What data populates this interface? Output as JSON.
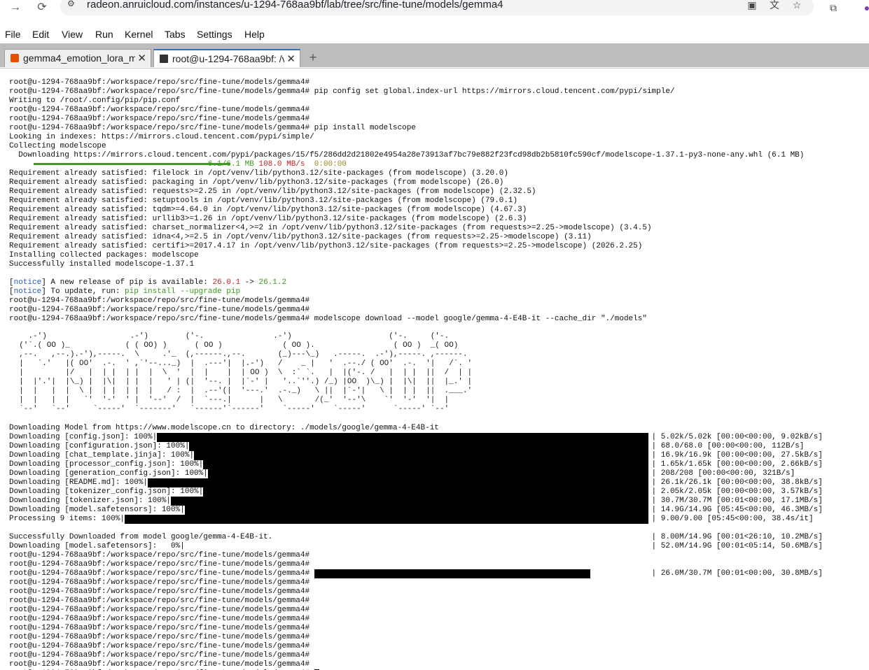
{
  "browser": {
    "url": "radeon.anruicloud.com/instances/u-1294-768aa9bf/lab/tree/src/fine-tune/models/gemma4"
  },
  "menu": [
    "File",
    "Edit",
    "View",
    "Run",
    "Kernel",
    "Tabs",
    "Settings",
    "Help"
  ],
  "tabs": [
    {
      "label": "gemma4_emotion_lora_m",
      "icon": "notebook-icon",
      "active": false
    },
    {
      "label": "root@u-1294-768aa9bf: /v",
      "icon": "terminal-icon",
      "active": true
    }
  ],
  "terminal": {
    "prompt": "root@u-1294-768aa9bf:/workspace/repo/src/fine-tune/models/gemma4#",
    "lines": [
      "root@u-1294-768aa9bf:/workspace/repo/src/fine-tune/models/gemma4#",
      "root@u-1294-768aa9bf:/workspace/repo/src/fine-tune/models/gemma4# pip config set global.index-url https://mirrors.cloud.tencent.com/pypi/simple/",
      "Writing to /root/.config/pip/pip.conf",
      "root@u-1294-768aa9bf:/workspace/repo/src/fine-tune/models/gemma4#",
      "root@u-1294-768aa9bf:/workspace/repo/src/fine-tune/models/gemma4#",
      "root@u-1294-768aa9bf:/workspace/repo/src/fine-tune/models/gemma4# pip install modelscope",
      "Looking in indexes: https://mirrors.cloud.tencent.com/pypi/simple/",
      "Collecting modelscope",
      "  Downloading https://mirrors.cloud.tencent.com/pypi/packages/15/f5/286dd2d21802e4954a28e73913af7bc79e882f23fcd98db2b5810fc590cf/modelscope-1.37.1-py3-none-any.whl (6.1 MB)"
    ],
    "progress_line": {
      "size": "6.1/6.1 MB",
      "speed": "108.0 MB/s",
      "eta": "0:00:00"
    },
    "requirements": [
      "Requirement already satisfied: filelock in /opt/venv/lib/python3.12/site-packages (from modelscope) (3.20.0)",
      "Requirement already satisfied: packaging in /opt/venv/lib/python3.12/site-packages (from modelscope) (26.0)",
      "Requirement already satisfied: requests>=2.25 in /opt/venv/lib/python3.12/site-packages (from modelscope) (2.32.5)",
      "Requirement already satisfied: setuptools in /opt/venv/lib/python3.12/site-packages (from modelscope) (79.0.1)",
      "Requirement already satisfied: tqdm>=4.64.0 in /opt/venv/lib/python3.12/site-packages (from modelscope) (4.67.3)",
      "Requirement already satisfied: urllib3>=1.26 in /opt/venv/lib/python3.12/site-packages (from modelscope) (2.6.3)",
      "Requirement already satisfied: charset_normalizer<4,>=2 in /opt/venv/lib/python3.12/site-packages (from requests>=2.25->modelscope) (3.4.5)",
      "Requirement already satisfied: idna<4,>=2.5 in /opt/venv/lib/python3.12/site-packages (from requests>=2.25->modelscope) (3.11)",
      "Requirement already satisfied: certifi>=2017.4.17 in /opt/venv/lib/python3.12/site-packages (from requests>=2.25->modelscope) (2026.2.25)",
      "Installing collected packages: modelscope",
      "Successfully installed modelscope-1.37.1"
    ],
    "notice1": {
      "tag": "notice",
      "text": " A new release of pip is available: ",
      "old": "26.0.1",
      "arrow": " -> ",
      "new": "26.1.2"
    },
    "notice2": {
      "tag": "notice",
      "text": " To update, run: ",
      "cmd": "pip install --upgrade pip"
    },
    "after_notice": [
      "root@u-1294-768aa9bf:/workspace/repo/src/fine-tune/models/gemma4#",
      "root@u-1294-768aa9bf:/workspace/repo/src/fine-tune/models/gemma4#",
      "root@u-1294-768aa9bf:/workspace/repo/src/fine-tune/models/gemma4# modelscope download --model google/gemma-4-E4B-it --cache_dir \"./models\""
    ],
    "downloading_header": "Downloading Model from https://www.modelscope.cn to directory: ./models/google/gemma-4-E4B-it",
    "downloads": [
      {
        "label": "Downloading [config.json]: 100%|",
        "stats": "| 5.02k/5.02k [00:00<00:00, 9.02kB/s]"
      },
      {
        "label": "Downloading [configuration.json]: 100%|",
        "stats": "| 68.0/68.0 [00:00<00:00, 112B/s]"
      },
      {
        "label": "Downloading [chat_template.jinja]: 100%|",
        "stats": "| 16.9k/16.9k [00:00<00:00, 27.5kB/s]"
      },
      {
        "label": "Downloading [processor_config.json]: 100%|",
        "stats": "| 1.65k/1.65k [00:00<00:00, 2.66kB/s]"
      },
      {
        "label": "Downloading [generation_config.json]: 100%|",
        "stats": "| 208/208 [00:00<00:00, 321B/s]"
      },
      {
        "label": "Downloading [README.md]: 100%|",
        "stats": "| 26.1k/26.1k [00:00<00:00, 38.8kB/s]"
      },
      {
        "label": "Downloading [tokenizer_config.json]: 100%|",
        "stats": "| 2.05k/2.05k [00:00<00:00, 3.57kB/s]"
      },
      {
        "label": "Downloading [tokenizer.json]: 100%|",
        "stats": "| 30.7M/30.7M [00:01<00:00, 17.1MB/s]"
      },
      {
        "label": "Downloading [model.safetensors]: 100%|",
        "stats": "| 14.9G/14.9G [05:45<00:00, 46.3MB/s]"
      },
      {
        "label": "Processing 9 items: 100%|",
        "stats": "| 9.00/9.00 [05:45<00:00, 38.4s/it]"
      }
    ],
    "success": "Successfully Downloaded from model google/gemma-4-E4B-it.",
    "stale1": "| 8.00M/14.9G [00:01<26:10, 10.2MB/s]",
    "stale_dl": "Downloading [model.safetensors]:   0%|",
    "stale2": "| 52.0M/14.9G [00:01<05:14, 50.6MB/s]",
    "stale3": "| 26.0M/30.7M [00:01<00:00, 30.8MB/s]",
    "tail_prompt_count": 12
  }
}
